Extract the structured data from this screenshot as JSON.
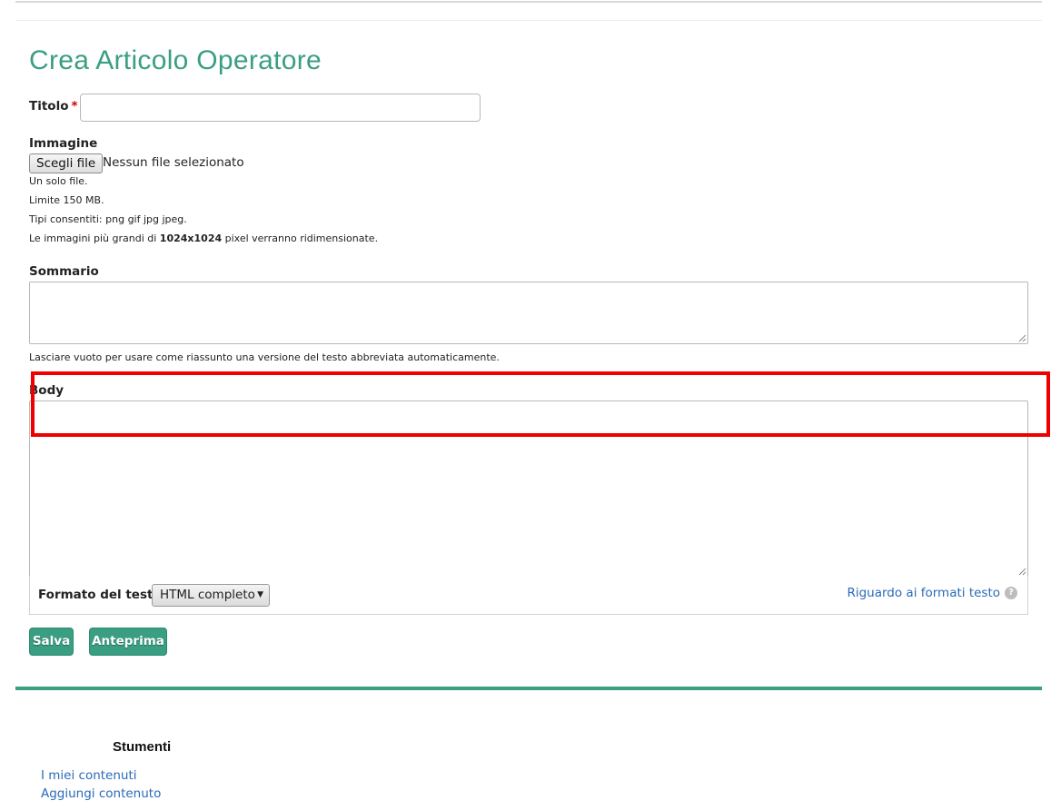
{
  "page": {
    "title": "Crea Articolo Operatore"
  },
  "form": {
    "title_field": {
      "label": "Titolo",
      "required_mark": "*",
      "value": ""
    },
    "image_field": {
      "label": "Immagine",
      "button_label": "Scegli file",
      "status": "Nessun file selezionato",
      "help": {
        "single_file": "Un solo file.",
        "limit": "Limite 150 MB.",
        "types": "Tipi consentiti: png gif jpg jpeg.",
        "resize_prefix": "Le immagini più grandi di ",
        "resize_size": "1024x1024",
        "resize_suffix": " pixel verranno ridimensionate."
      }
    },
    "summary_field": {
      "label": "Sommario",
      "value": "",
      "help": "Lasciare vuoto per usare come riassunto una versione del testo abbreviata automaticamente."
    },
    "body_field": {
      "label": "Body",
      "value": ""
    },
    "text_format": {
      "label": "Formato del testo",
      "selected": "HTML completo",
      "help_link": "Riguardo ai formati testo",
      "help_icon": "question-icon"
    },
    "actions": {
      "save_label": "Salva",
      "preview_label": "Anteprima"
    }
  },
  "sidebar_tools": {
    "title": "Stumenti",
    "links": [
      "I miei contenuti",
      "Aggiungi contenuto"
    ]
  },
  "colors": {
    "accent": "#3a9e82",
    "link": "#2a6ab8",
    "highlight": "#ee0000",
    "required": "#cc0000"
  }
}
